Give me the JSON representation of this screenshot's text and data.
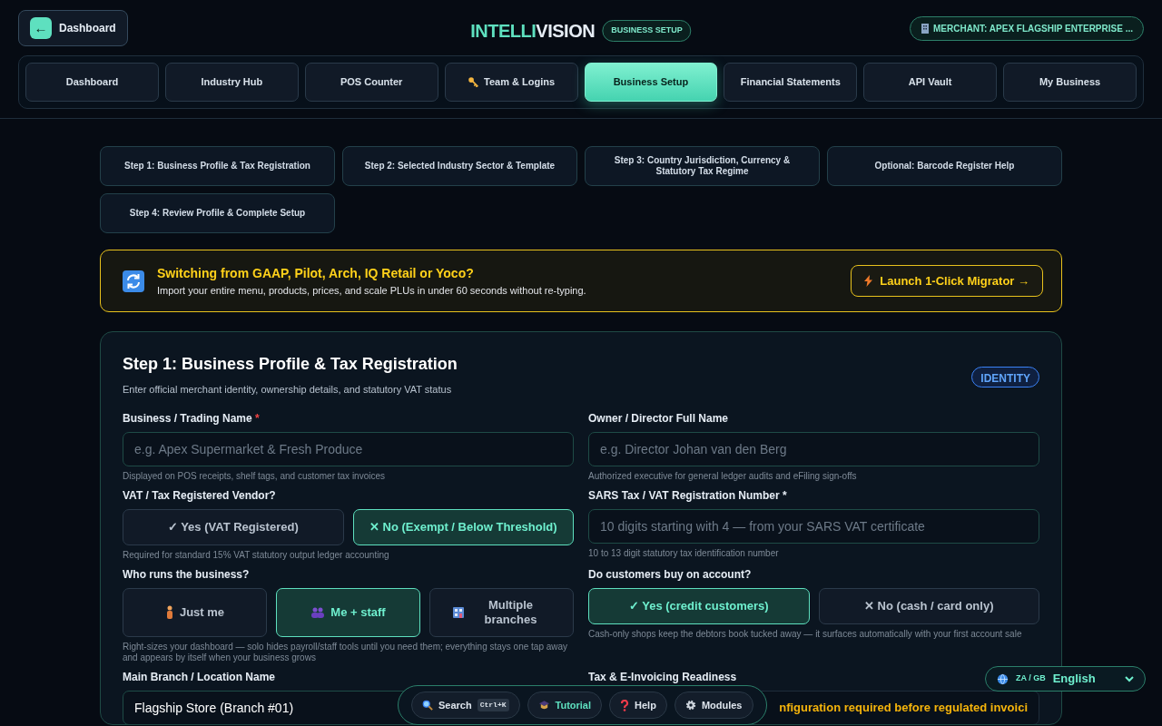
{
  "header": {
    "back_button": {
      "arrow": "←",
      "label": "Dashboard"
    },
    "brand": {
      "accent": "INTELLI",
      "rest": "VISION"
    },
    "brand_badge": "BUSINESS SETUP",
    "merchant": "MERCHANT: APEX FLAGSHIP ENTERPRISE ..."
  },
  "nav_tabs": [
    {
      "label": "Dashboard",
      "selected": false
    },
    {
      "label": "Industry Hub",
      "selected": false
    },
    {
      "label": "POS Counter",
      "selected": false
    },
    {
      "label": "Team & Logins",
      "selected": false
    },
    {
      "label": "Business Setup",
      "selected": true
    },
    {
      "label": "Financial Statements",
      "selected": false
    },
    {
      "label": "API Vault",
      "selected": false
    },
    {
      "label": "My Business",
      "selected": false
    }
  ],
  "steps": [
    {
      "label": "Step 1: Business Profile & Tax Registration"
    },
    {
      "label": "Step 2: Selected Industry Sector & Template"
    },
    {
      "label": "Step 3: Country Jurisdiction, Currency & Statutory Tax Regime"
    },
    {
      "label": "Optional: Barcode Register Help"
    },
    {
      "label": "Step 4: Review Profile & Complete Setup"
    }
  ],
  "banner": {
    "title": "Switching from GAAP, Pilot, Arch, IQ Retail or Yoco?",
    "text": "Import your entire menu, products, prices, and scale PLUs in under 60 seconds without re-typing.",
    "button": "Launch 1-Click Migrator →"
  },
  "form": {
    "title": "Step 1: Business Profile & Tax Registration",
    "subtitle": "Enter official merchant identity, ownership details, and statutory VAT status",
    "badge": "IDENTITY",
    "fields": [
      {
        "kind": "text",
        "label": "Business / Trading Name",
        "required_mark": "*",
        "placeholder": "e.g. Apex Supermarket & Fresh Produce",
        "hint": "Displayed on POS receipts, shelf tags, and customer tax invoices"
      },
      {
        "kind": "text",
        "label": "Owner / Director Full Name",
        "placeholder": "e.g. Director Johan van den Berg",
        "hint": "Authorized executive for general ledger audits and eFiling sign-offs"
      },
      {
        "kind": "choice",
        "label": "VAT / Tax Registered Vendor?",
        "options": [
          {
            "label": "✓ Yes (VAT Registered)",
            "selected": false
          },
          {
            "label": "✕ No (Exempt / Below Threshold)",
            "selected": true
          }
        ],
        "hint": "Required for standard 15% VAT statutory output ledger accounting"
      },
      {
        "kind": "text",
        "label": "SARS Tax / VAT Registration Number *",
        "placeholder": "10 digits starting with 4 — from your SARS VAT certificate",
        "hint": "10 to 13 digit statutory tax identification number"
      },
      {
        "kind": "choice",
        "label": "Who runs the business?",
        "options": [
          {
            "label": "Just me",
            "selected": false
          },
          {
            "label": "Me + staff",
            "selected": true
          },
          {
            "label": "Multiple branches",
            "selected": false
          }
        ],
        "hint": "Right-sizes your dashboard — solo hides payroll/staff tools until you need them; everything stays one tap away and appears by itself when your business grows"
      },
      {
        "kind": "choice",
        "label": "Do customers buy on account?",
        "options": [
          {
            "label": "✓ Yes (credit customers)",
            "selected": true
          },
          {
            "label": "✕ No (cash / card only)",
            "selected": false
          }
        ],
        "hint": "Cash-only shops keep the debtors book tucked away — it surfaces automatically with your first account sale"
      },
      {
        "kind": "text",
        "label": "Main Branch / Location Name",
        "value": "Flagship Store (Branch #01)"
      },
      {
        "kind": "status",
        "label": "Tax & E-Invoicing Readiness",
        "value": "nfiguration required before regulated invoici"
      }
    ]
  },
  "toolbar": [
    {
      "label": "Search",
      "kbd": "Ctrl+K",
      "active": false
    },
    {
      "label": "Tutorial",
      "active": true
    },
    {
      "label": "Help",
      "active": false
    },
    {
      "label": "Modules",
      "active": false
    }
  ],
  "language": {
    "flags": "ZA / GB",
    "label": "English"
  }
}
